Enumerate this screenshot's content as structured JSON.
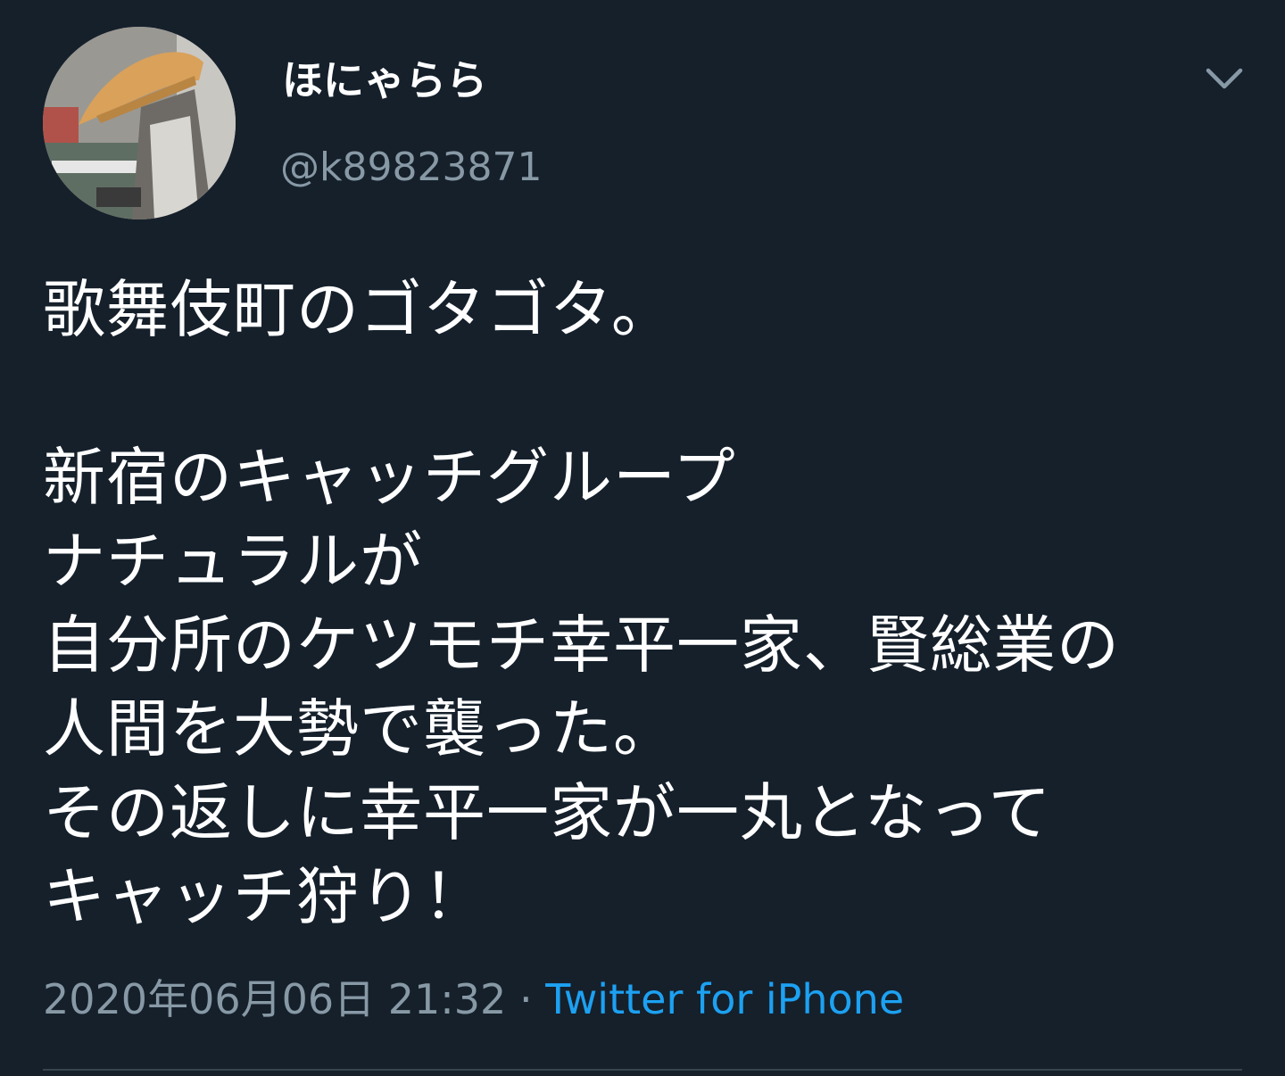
{
  "user": {
    "display_name": "ほにゃらら",
    "handle": "@k89823871"
  },
  "tweet": {
    "lines": [
      "歌舞伎町のゴタゴタ。",
      "",
      "新宿のキャッチグループ",
      "ナチュラルが",
      "自分所のケツモチ幸平一家、賢総業の",
      "人間を大勢で襲った。",
      "その返しに幸平一家が一丸となって",
      "キャッチ狩り！"
    ],
    "timestamp": "2020年06月06日 21:32",
    "separator": " · ",
    "source": "Twitter for iPhone"
  },
  "icons": {
    "menu": "chevron-down-icon",
    "avatar": "user-avatar"
  },
  "colors": {
    "background": "#15202b",
    "text": "#ffffff",
    "secondary": "#8899a6",
    "link": "#1da1f2",
    "divider": "#38444d"
  }
}
